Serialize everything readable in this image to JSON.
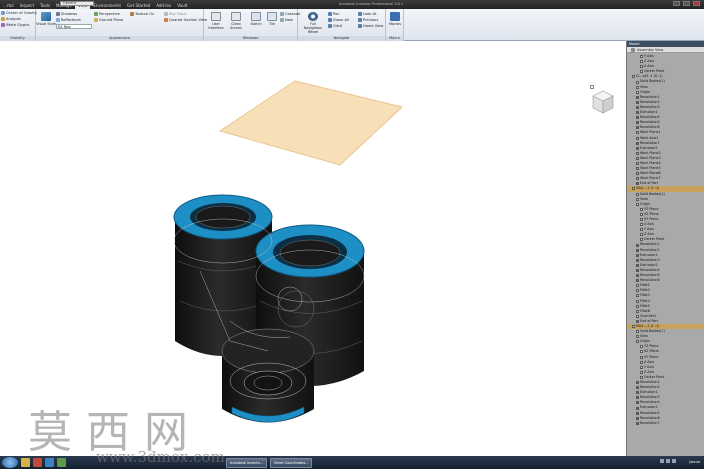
{
  "app": {
    "window_title": "Autodesk Inventor Professional 2011",
    "qa_combo": "Generic",
    "qa_combo2": "Assembly"
  },
  "tabs": [
    "...rtol",
    "Inspect",
    "Tools",
    "Manage",
    "View",
    "Environments",
    "Get Started",
    "Add-Ins",
    "Vault"
  ],
  "ribbon": {
    "panels": [
      {
        "label": "Visibility",
        "items": [
          "Center of Gravity",
          "Analysis",
          "iMate Glyphs"
        ]
      },
      {
        "label": "Appearance",
        "items": [
          "Visual Style",
          "Shadows",
          "Reflections",
          "Perspective",
          "Ground Plane",
          "Texture On",
          "Ray Trace",
          "Quarter Section View"
        ],
        "combo": "Ed Nav"
      },
      {
        "label": "Windows",
        "items": [
          "User Interface",
          "Clean Screen",
          "Switch",
          "Tile",
          "Cascade",
          "Close All",
          "New"
        ]
      },
      {
        "label": "Navigate",
        "items": [
          "Full Navigation Wheel",
          "Pan",
          "Zoom All",
          "Orbit",
          "Look At",
          "Previous",
          "Home View"
        ]
      },
      {
        "label": "Macro",
        "items": [
          "Macros"
        ]
      }
    ]
  },
  "browser": {
    "title": "Model",
    "view_dropdown": "Assembly View",
    "rows": [
      {
        "t": "Y Axis",
        "i": 3,
        "c": "#f2f2f2"
      },
      {
        "t": "Z Axis",
        "i": 3,
        "c": "#f2f2f2"
      },
      {
        "t": "X Axis",
        "i": 3,
        "c": "#f2f2f2"
      },
      {
        "t": "Center Point",
        "i": 3,
        "c": "#f2f2f2"
      },
      {
        "t": "Cl...s43 :1 (0 :1)",
        "i": 1,
        "c": "#e8e8e8"
      },
      {
        "t": "Solid Bodies(1)",
        "i": 2,
        "c": "#e8e8e8"
      },
      {
        "t": "View",
        "i": 2,
        "c": "#e8e8e8"
      },
      {
        "t": "Origin",
        "i": 2,
        "c": "#e8e8e8"
      },
      {
        "t": "Revolution1",
        "i": 2,
        "c": "#3b6fb5"
      },
      {
        "t": "Revolution2",
        "i": 2,
        "c": "#3b6fb5"
      },
      {
        "t": "Revolution3",
        "i": 2,
        "c": "#3b6fb5"
      },
      {
        "t": "Extrusion1",
        "i": 2,
        "c": "#3b6fb5"
      },
      {
        "t": "Revolution4",
        "i": 2,
        "c": "#3b6fb5"
      },
      {
        "t": "Revolution5",
        "i": 2,
        "c": "#3b6fb5"
      },
      {
        "t": "Revolution6",
        "i": 2,
        "c": "#3b6fb5"
      },
      {
        "t": "Work Plane1",
        "i": 2,
        "c": "#d9b86a"
      },
      {
        "t": "Work Axis1",
        "i": 2,
        "c": "#d9b86a"
      },
      {
        "t": "Revolution7",
        "i": 2,
        "c": "#3b6fb5"
      },
      {
        "t": "Extrusion2",
        "i": 2,
        "c": "#3b6fb5"
      },
      {
        "t": "Work Plane2",
        "i": 2,
        "c": "#d9b86a"
      },
      {
        "t": "Work Plane3",
        "i": 2,
        "c": "#d9b86a"
      },
      {
        "t": "Work Plane4",
        "i": 2,
        "c": "#d9b86a"
      },
      {
        "t": "Work Plane5",
        "i": 2,
        "c": "#d9b86a"
      },
      {
        "t": "Work Plane6",
        "i": 2,
        "c": "#d9b86a"
      },
      {
        "t": "Work Plane7",
        "i": 2,
        "c": "#d9b86a"
      },
      {
        "t": "End of Part",
        "i": 2,
        "c": "#c0392b"
      },
      {
        "t": "M04...:1 (1 :1)",
        "i": 1,
        "c": "#e8e8e8",
        "sel": true
      },
      {
        "t": "Solid Bodies(1)",
        "i": 2,
        "c": "#e8e8e8"
      },
      {
        "t": "View",
        "i": 2,
        "c": "#e8e8e8"
      },
      {
        "t": "Origin",
        "i": 2,
        "c": "#e8e8e8"
      },
      {
        "t": "YZ Plane",
        "i": 3,
        "c": "#f2f2f2"
      },
      {
        "t": "XZ Plane",
        "i": 3,
        "c": "#f2f2f2"
      },
      {
        "t": "XY Plane",
        "i": 3,
        "c": "#f2f2f2"
      },
      {
        "t": "X Axis",
        "i": 3,
        "c": "#f2f2f2"
      },
      {
        "t": "Y Axis",
        "i": 3,
        "c": "#f2f2f2"
      },
      {
        "t": "Z Axis",
        "i": 3,
        "c": "#f2f2f2"
      },
      {
        "t": "Center Point",
        "i": 3,
        "c": "#f2f2f2"
      },
      {
        "t": "Revolution1",
        "i": 2,
        "c": "#3b6fb5"
      },
      {
        "t": "Revolution2",
        "i": 2,
        "c": "#3b6fb5"
      },
      {
        "t": "Extrusion1",
        "i": 2,
        "c": "#3b6fb5"
      },
      {
        "t": "Revolution3",
        "i": 2,
        "c": "#3b6fb5"
      },
      {
        "t": "Extrusion2",
        "i": 2,
        "c": "#3b6fb5"
      },
      {
        "t": "Revolution4",
        "i": 2,
        "c": "#3b6fb5"
      },
      {
        "t": "Revolution5",
        "i": 2,
        "c": "#3b6fb5"
      },
      {
        "t": "Revolution6",
        "i": 2,
        "c": "#3b6fb5"
      },
      {
        "t": "Fillet1",
        "i": 2,
        "c": "#e8e8e8"
      },
      {
        "t": "Fillet2",
        "i": 2,
        "c": "#e8e8e8"
      },
      {
        "t": "Fillet3",
        "i": 2,
        "c": "#e8e8e8"
      },
      {
        "t": "Fillet4",
        "i": 2,
        "c": "#e8e8e8"
      },
      {
        "t": "Fillet5",
        "i": 2,
        "c": "#e8e8e8"
      },
      {
        "t": "Fillet6",
        "i": 2,
        "c": "#e8e8e8"
      },
      {
        "t": "Chamfer1",
        "i": 2,
        "c": "#e8e8e8"
      },
      {
        "t": "End of Part",
        "i": 2,
        "c": "#c0392b"
      },
      {
        "t": "M04...:1 (1 :1)",
        "i": 1,
        "c": "#e8e8e8",
        "sel": true
      },
      {
        "t": "Solid Bodies(1)",
        "i": 2,
        "c": "#e8e8e8"
      },
      {
        "t": "View",
        "i": 2,
        "c": "#e8e8e8"
      },
      {
        "t": "Origin",
        "i": 2,
        "c": "#e8e8e8"
      },
      {
        "t": "YZ Plane",
        "i": 3,
        "c": "#f2f2f2"
      },
      {
        "t": "XZ Plane",
        "i": 3,
        "c": "#f2f2f2"
      },
      {
        "t": "XY Plane",
        "i": 3,
        "c": "#f2f2f2"
      },
      {
        "t": "X Axis",
        "i": 3,
        "c": "#f2f2f2"
      },
      {
        "t": "Y Axis",
        "i": 3,
        "c": "#f2f2f2"
      },
      {
        "t": "Z Axis",
        "i": 3,
        "c": "#f2f2f2"
      },
      {
        "t": "Center Point",
        "i": 3,
        "c": "#f2f2f2"
      },
      {
        "t": "Revolution1",
        "i": 2,
        "c": "#3b6fb5"
      },
      {
        "t": "Revolution2",
        "i": 2,
        "c": "#3b6fb5"
      },
      {
        "t": "Extrusion1",
        "i": 2,
        "c": "#3b6fb5"
      },
      {
        "t": "Revolution3",
        "i": 2,
        "c": "#3b6fb5"
      },
      {
        "t": "Revolution4",
        "i": 2,
        "c": "#3b6fb5"
      },
      {
        "t": "Extrusion2",
        "i": 2,
        "c": "#3b6fb5"
      },
      {
        "t": "Revolution5",
        "i": 2,
        "c": "#3b6fb5"
      },
      {
        "t": "Revolution6",
        "i": 2,
        "c": "#3b6fb5"
      },
      {
        "t": "Revolution7",
        "i": 2,
        "c": "#3b6fb5"
      }
    ]
  },
  "taskbar": {
    "items": [
      "Autodesk Invento...",
      "Sheet Coordinates..."
    ],
    "clock": "Jiaxue",
    "start_color": "#4a8fd4"
  },
  "watermark": {
    "text": "莫西网",
    "url": "www.3dmox.com"
  },
  "colors": {
    "accent_blue": "#1e8fc4",
    "sketch_plane": "#f7dfb8",
    "body_dark": "#1f1f1f"
  }
}
